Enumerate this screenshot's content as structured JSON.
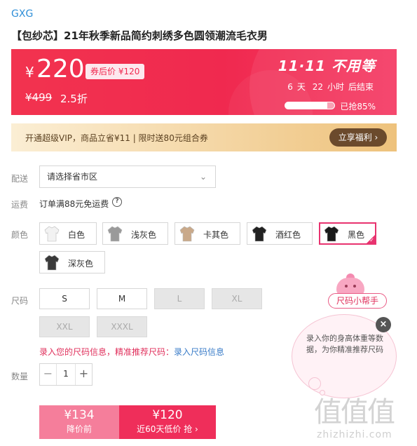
{
  "product": {
    "brand": "GXG",
    "title": "【包纱芯】21年秋季新品简约刺绣多色圆领潮流毛衣男"
  },
  "price_banner": {
    "currency": "¥",
    "price": "220",
    "coupon_label": "券后价 ¥120",
    "original_price": "¥499",
    "discount": "2.5折",
    "event_title": "11·11 不用等",
    "countdown": {
      "days": "6",
      "days_unit": "天",
      "hours": "22",
      "hours_unit": "小时",
      "suffix": "后结束"
    },
    "sold_percent": 85,
    "sold_text": "已抢85%",
    "accent_color": "#f0294f"
  },
  "vip_bar": {
    "text": "开通超级VIP，商品立省¥11 | 限时送80元组合券",
    "button_label": "立享福利 ›"
  },
  "labels": {
    "delivery": "配送",
    "shipping": "运费",
    "color": "颜色",
    "size": "尺码",
    "quantity": "数量"
  },
  "delivery": {
    "placeholder": "请选择省市区",
    "chevron": "chevron-down-icon"
  },
  "shipping": {
    "text": "订单满88元免运费",
    "help_icon": "?"
  },
  "colors": [
    {
      "label": "白色",
      "swatch": "#f2f2f2",
      "selected": false
    },
    {
      "label": "浅灰色",
      "swatch": "#9a9a9a",
      "selected": false
    },
    {
      "label": "卡其色",
      "swatch": "#c9a98a",
      "selected": false
    },
    {
      "label": "酒红色",
      "swatch": "#222222",
      "selected": false
    },
    {
      "label": "黑色",
      "swatch": "#1a1a1a",
      "selected": true
    },
    {
      "label": "深灰色",
      "swatch": "#3a3a3a",
      "selected": false
    }
  ],
  "sizes": [
    {
      "label": "S",
      "available": true
    },
    {
      "label": "M",
      "available": true
    },
    {
      "label": "L",
      "available": false
    },
    {
      "label": "XL",
      "available": false
    },
    {
      "label": "XXL",
      "available": false
    },
    {
      "label": "XXXL",
      "available": false
    }
  ],
  "size_hint": {
    "text": "录入您的尺码信息，精准推荐尺码：",
    "link": "录入尺码信息"
  },
  "quantity": {
    "minus": "−",
    "value": "1",
    "plus": "+"
  },
  "buy": {
    "left_price": "¥134",
    "left_sub": "降价前",
    "right_price": "¥120",
    "right_sub": "近60天低价 抢 ›"
  },
  "size_helper": {
    "pill": "尺码小帮手",
    "text": "录入你的身高体重等数据，为你精准推荐尺码",
    "close": "×"
  },
  "watermark": {
    "main": "值值值",
    "sub": "zhizhizhi.com"
  }
}
